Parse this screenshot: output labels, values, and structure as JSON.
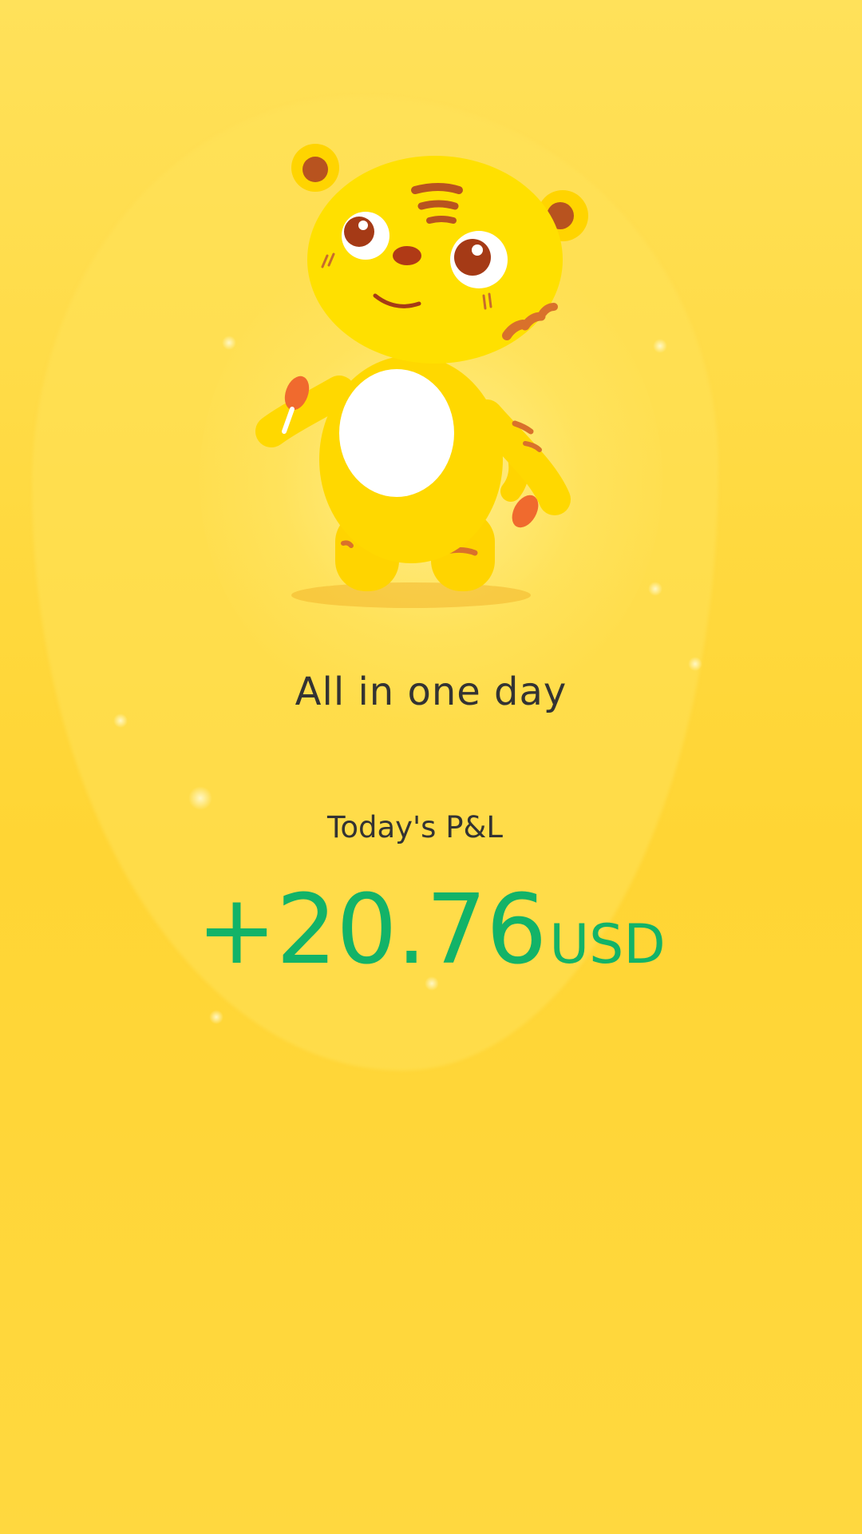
{
  "hero": {
    "mascot_icon": "tiger-mascot-icon",
    "tagline": "All in one day"
  },
  "pnl": {
    "label": "Today's P&L",
    "amount": "+20.76",
    "currency": "USD",
    "color": "#12b368"
  },
  "colors": {
    "background": "#ffd93f",
    "text_primary": "#333333"
  }
}
